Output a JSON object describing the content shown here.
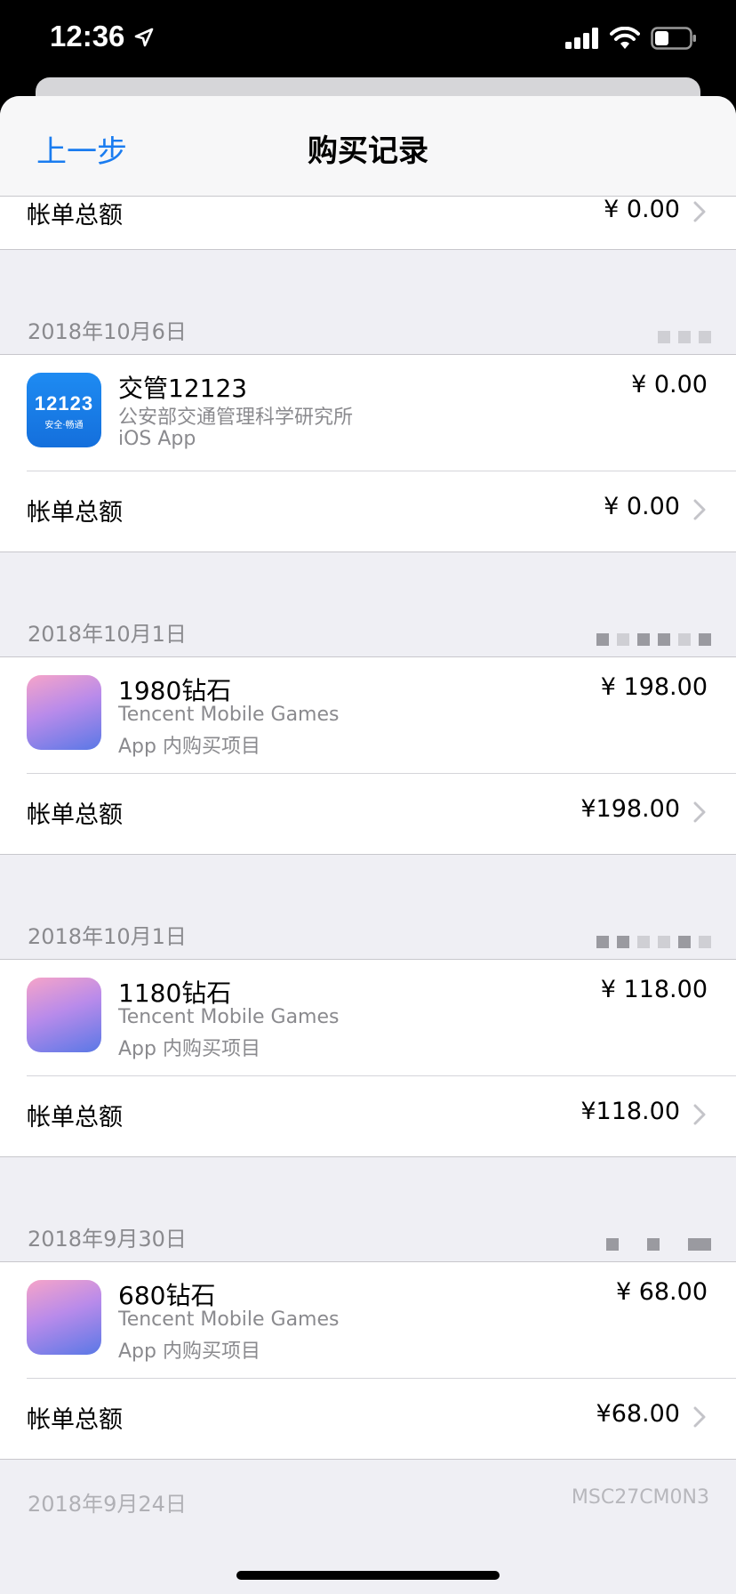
{
  "status": {
    "time": "12:36"
  },
  "nav": {
    "back": "上一步",
    "title": "购买记录"
  },
  "top_total": {
    "label": "帐单总额",
    "price": "¥ 0.00"
  },
  "groups": [
    {
      "date": "2018年10月6日",
      "item": {
        "name": "交管12123",
        "developer": "公安部交通管理科学研究所",
        "kind": "iOS App",
        "price": "¥ 0.00",
        "icon": "jiaoguan-12123-icon",
        "icon_text": "12123",
        "icon_sub": "安全·畅通"
      },
      "total": {
        "label": "帐单总额",
        "price": "¥ 0.00"
      }
    },
    {
      "date": "2018年10月1日",
      "item": {
        "name": "1980钻石",
        "developer": "Tencent Mobile Games",
        "kind": "App 内购买项目",
        "price": "¥ 198.00",
        "icon": "game-icon"
      },
      "total": {
        "label": "帐单总额",
        "price": "¥198.00"
      }
    },
    {
      "date": "2018年10月1日",
      "item": {
        "name": "1180钻石",
        "developer": "Tencent Mobile Games",
        "kind": "App 内购买项目",
        "price": "¥ 118.00",
        "icon": "game-icon"
      },
      "total": {
        "label": "帐单总额",
        "price": "¥118.00"
      }
    },
    {
      "date": "2018年9月30日",
      "item": {
        "name": "680钻石",
        "developer": "Tencent Mobile Games",
        "kind": "App 内购买项目",
        "price": "¥ 68.00",
        "icon": "game-icon"
      },
      "total": {
        "label": "帐单总额",
        "price": "¥68.00"
      }
    }
  ],
  "partial_next": {
    "date": "2018年9月24日",
    "code": "MSC27CM0N3"
  }
}
